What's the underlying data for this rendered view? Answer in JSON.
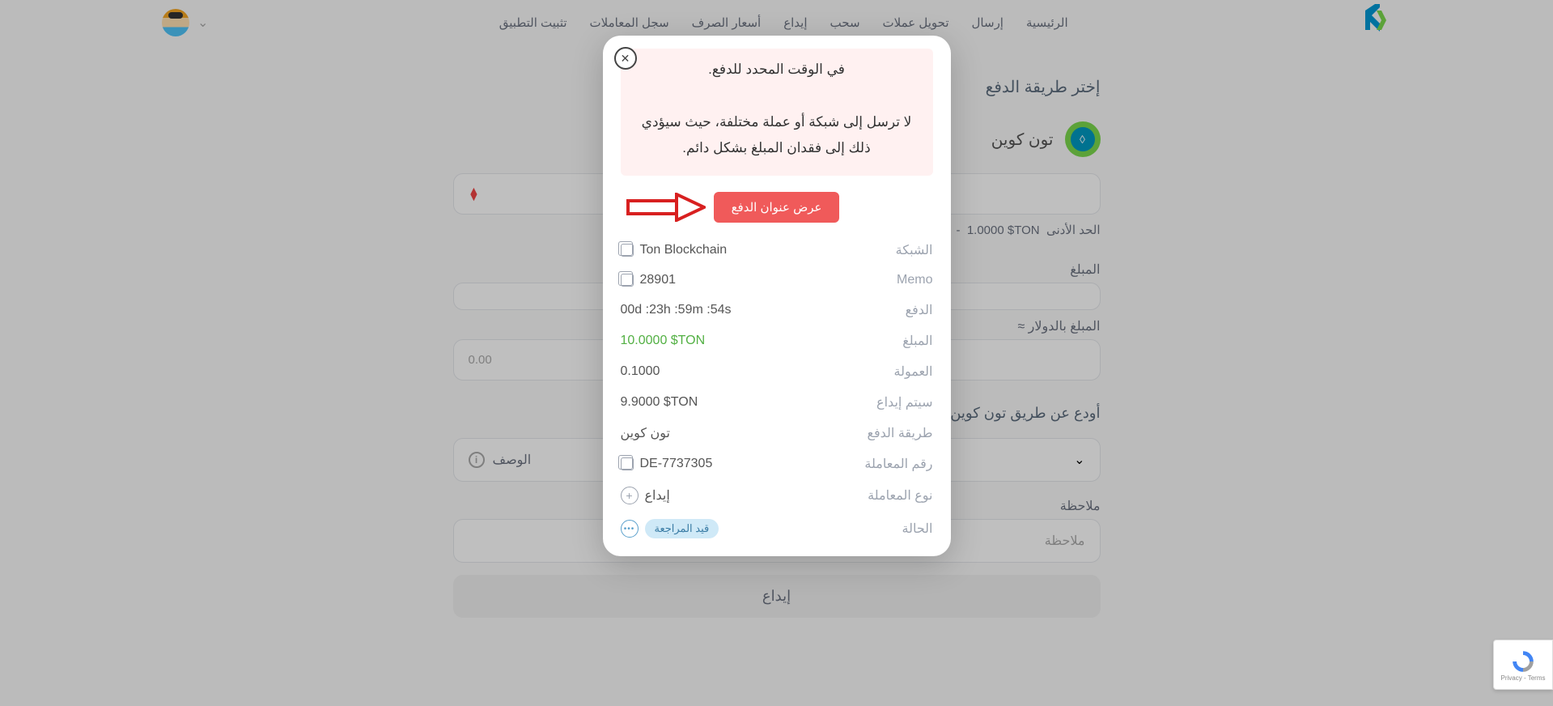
{
  "nav": {
    "items": [
      "الرئيسية",
      "إرسال",
      "تحويل عملات",
      "سحب",
      "إيداع",
      "أسعار الصرف",
      "سجل المعاملات",
      "تثبيت التطبيق"
    ]
  },
  "page": {
    "title": "إختر طريقة الدفع",
    "methodName": "تون كوين",
    "minLabel": "الحد الأدنى",
    "minValue": "1.0000 $TON",
    "amountLabel": "المبلغ",
    "dollarLabel": "المبلغ بالدولار ≈",
    "dollarValue": "0.00",
    "sectionTitle": "أودع عن طريق تون كوين",
    "descLabel": "الوصف",
    "noteLabel": "ملاحظة",
    "notePlaceholder": "ملاحظة",
    "submitLabel": "إيداع"
  },
  "modal": {
    "warningLine1": "في الوقت المحدد للدفع.",
    "warningLine2": "لا ترسل إلى شبكة أو عملة مختلفة، حيث سيؤدي ذلك إلى فقدان المبلغ بشكل دائم.",
    "showAddressLabel": "عرض عنوان الدفع",
    "rows": {
      "network": {
        "label": "الشبكة",
        "value": "Ton Blockchain"
      },
      "memo": {
        "label": "Memo",
        "value": "28901"
      },
      "payWithin": {
        "label": "الدفع",
        "value": "00d :23h :59m :54s"
      },
      "amount": {
        "label": "المبلغ",
        "value": "10.0000 $TON"
      },
      "fee": {
        "label": "العمولة",
        "value": "0.1000"
      },
      "willDeposit": {
        "label": "سيتم إيداع",
        "value": "9.9000 $TON"
      },
      "paymentMethod": {
        "label": "طريقة الدفع",
        "value": "تون كوين"
      },
      "txNo": {
        "label": "رقم المعاملة",
        "value": "DE-7737305"
      },
      "txType": {
        "label": "نوع المعاملة",
        "value": "إيداع"
      },
      "status": {
        "label": "الحالة",
        "badge": "قيد المراجعة"
      }
    }
  },
  "recaptcha": {
    "text": "Privacy - Terms"
  }
}
